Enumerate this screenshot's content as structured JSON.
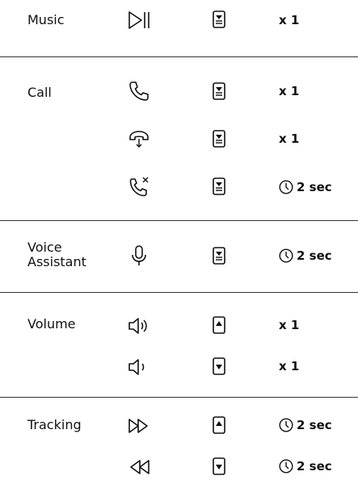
{
  "sections": [
    {
      "label": "Music",
      "rows": [
        {
          "function_icon": "play-pause-icon",
          "gesture_icon": "mfb-button-icon",
          "action": "x 1"
        }
      ]
    },
    {
      "label": "Call",
      "rows": [
        {
          "function_icon": "phone-answer-icon",
          "gesture_icon": "mfb-button-icon",
          "action": "x 1"
        },
        {
          "function_icon": "phone-hangup-icon",
          "gesture_icon": "mfb-button-icon",
          "action": "x 1"
        },
        {
          "function_icon": "phone-reject-icon",
          "gesture_icon": "mfb-button-icon",
          "action": "2 sec"
        }
      ]
    },
    {
      "label": "Voice\nAssistant",
      "rows": [
        {
          "function_icon": "microphone-icon",
          "gesture_icon": "mfb-button-icon",
          "action": "2 sec"
        }
      ]
    },
    {
      "label": "Volume",
      "rows": [
        {
          "function_icon": "volume-up-icon",
          "gesture_icon": "volume-up-button-icon",
          "action": "x 1"
        },
        {
          "function_icon": "volume-down-icon",
          "gesture_icon": "volume-down-button-icon",
          "action": "x 1"
        }
      ]
    },
    {
      "label": "Tracking",
      "rows": [
        {
          "function_icon": "next-track-icon",
          "gesture_icon": "volume-up-button-icon",
          "action": "2 sec"
        },
        {
          "function_icon": "previous-track-icon",
          "gesture_icon": "volume-down-button-icon",
          "action": "2 sec"
        }
      ]
    }
  ],
  "colors": {
    "text": "#111111",
    "divider": "#333333",
    "background": "#ffffff"
  }
}
